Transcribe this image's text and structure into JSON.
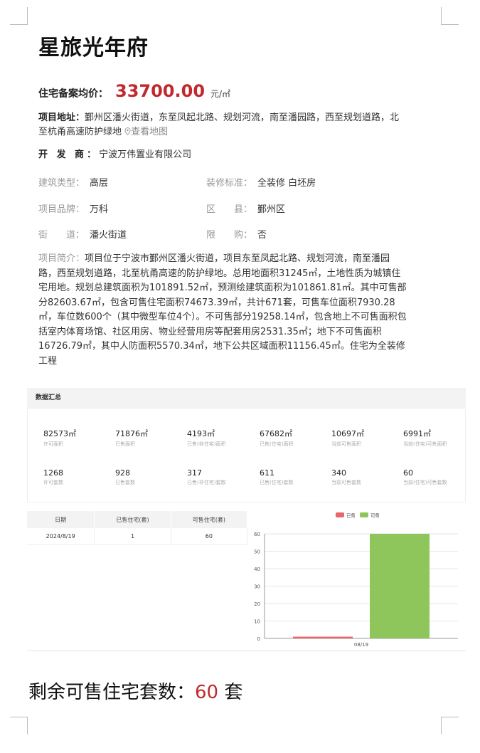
{
  "title": "星旅光年府",
  "price": {
    "label": "住宅备案均价：",
    "value": "33700.00",
    "unit": "元/㎡"
  },
  "address": {
    "label": "项目地址：",
    "value": "鄞州区潘火街道，东至凤起北路、规划河流，南至潘园路，西至规划道路，北至杭甬高速防护绿地",
    "map_icon": "location-pin-icon",
    "map_link": "查看地图"
  },
  "developer": {
    "label": "开 发 商：",
    "value": "宁波万伟置业有限公司"
  },
  "attributes": [
    {
      "k": "建筑类型：",
      "v": "高层"
    },
    {
      "k": "装修标准：",
      "v": "全装修 白坯房"
    },
    {
      "k": "项目品牌：",
      "v": "万科"
    },
    {
      "k": "区　　县：",
      "v": "鄞州区"
    },
    {
      "k": "街　　道：",
      "v": "潘火街道"
    },
    {
      "k": "限　　购：",
      "v": "否"
    }
  ],
  "intro": {
    "label": "项目简介：",
    "text": "项目位于宁波市鄞州区潘火街道，项目东至凤起北路、规划河流，南至潘园路，西至规划道路，北至杭甬高速的防护绿地。总用地面积31245㎡，土地性质为城镇住宅用地。规划总建筑面积为101891.52㎡，预测绘建筑面积为101861.81㎡。其中可售部分82603.67㎡，包含可售住宅面积74673.39㎡，共计671套，可售车位面积7930.28㎡，车位数600个（其中微型车位4个）。不可售部分19258.14㎡，包含地上不可售面积包括室内体育场馆、社区用房、物业经营用房等配套用房2531.35㎡；地下不可售面积16726.79㎡，其中人防面积5570.34㎡，地下公共区域面积11156.45㎡。住宅为全装修工程"
  },
  "summary": {
    "title": "数据汇总",
    "stats": [
      {
        "n": "82573㎡",
        "l": "许可面积"
      },
      {
        "n": "71876㎡",
        "l": "已售面积"
      },
      {
        "n": "4193㎡",
        "l": "已售(非住宅)面积"
      },
      {
        "n": "67682㎡",
        "l": "已售(住宅)面积"
      },
      {
        "n": "10697㎡",
        "l": "当前可售面积"
      },
      {
        "n": "6991㎡",
        "l": "当前(住宅)可售面积"
      },
      {
        "n": "1268",
        "l": "许可套数"
      },
      {
        "n": "928",
        "l": "已售套数"
      },
      {
        "n": "317",
        "l": "已售(非住宅)套数"
      },
      {
        "n": "611",
        "l": "已售(住宅)套数"
      },
      {
        "n": "340",
        "l": "当前可售套数"
      },
      {
        "n": "60",
        "l": "当前(住宅)可售套数"
      }
    ]
  },
  "table": {
    "headers": [
      "日期",
      "已售住宅(套)",
      "可售住宅(套)"
    ],
    "rows": [
      [
        "2024/8/19",
        "1",
        "60"
      ]
    ]
  },
  "chart_data": {
    "type": "bar",
    "categories": [
      "08/19"
    ],
    "series": [
      {
        "name": "已售",
        "values": [
          1
        ],
        "color": "#e8666a"
      },
      {
        "name": "可售",
        "values": [
          60
        ],
        "color": "#8fc65c"
      }
    ],
    "ylim": [
      0,
      60
    ],
    "yticks": [
      "0",
      "10",
      "20",
      "30",
      "40",
      "50",
      "60"
    ],
    "grid": true,
    "legend": "top-center"
  },
  "remaining": {
    "label": "剩余可售住宅套数：",
    "value": "60",
    "unit": "套"
  }
}
